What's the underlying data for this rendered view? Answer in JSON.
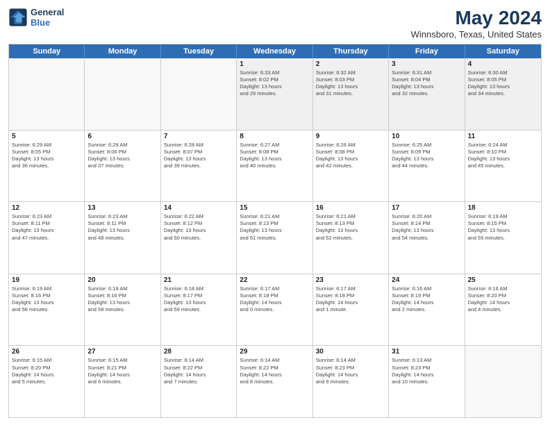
{
  "logo": {
    "line1": "General",
    "line2": "Blue"
  },
  "title": "May 2024",
  "subtitle": "Winnsboro, Texas, United States",
  "header_days": [
    "Sunday",
    "Monday",
    "Tuesday",
    "Wednesday",
    "Thursday",
    "Friday",
    "Saturday"
  ],
  "weeks": [
    [
      {
        "day": "",
        "info": ""
      },
      {
        "day": "",
        "info": ""
      },
      {
        "day": "",
        "info": ""
      },
      {
        "day": "1",
        "info": "Sunrise: 6:33 AM\nSunset: 8:02 PM\nDaylight: 13 hours\nand 29 minutes."
      },
      {
        "day": "2",
        "info": "Sunrise: 6:32 AM\nSunset: 8:03 PM\nDaylight: 13 hours\nand 31 minutes."
      },
      {
        "day": "3",
        "info": "Sunrise: 6:31 AM\nSunset: 8:04 PM\nDaylight: 13 hours\nand 32 minutes."
      },
      {
        "day": "4",
        "info": "Sunrise: 6:30 AM\nSunset: 8:05 PM\nDaylight: 13 hours\nand 34 minutes."
      }
    ],
    [
      {
        "day": "5",
        "info": "Sunrise: 6:29 AM\nSunset: 8:05 PM\nDaylight: 13 hours\nand 36 minutes."
      },
      {
        "day": "6",
        "info": "Sunrise: 6:28 AM\nSunset: 8:06 PM\nDaylight: 13 hours\nand 37 minutes."
      },
      {
        "day": "7",
        "info": "Sunrise: 6:28 AM\nSunset: 8:07 PM\nDaylight: 13 hours\nand 39 minutes."
      },
      {
        "day": "8",
        "info": "Sunrise: 6:27 AM\nSunset: 8:08 PM\nDaylight: 13 hours\nand 40 minutes."
      },
      {
        "day": "9",
        "info": "Sunrise: 6:26 AM\nSunset: 8:08 PM\nDaylight: 13 hours\nand 42 minutes."
      },
      {
        "day": "10",
        "info": "Sunrise: 6:25 AM\nSunset: 8:09 PM\nDaylight: 13 hours\nand 44 minutes."
      },
      {
        "day": "11",
        "info": "Sunrise: 6:24 AM\nSunset: 8:10 PM\nDaylight: 13 hours\nand 45 minutes."
      }
    ],
    [
      {
        "day": "12",
        "info": "Sunrise: 6:23 AM\nSunset: 8:11 PM\nDaylight: 13 hours\nand 47 minutes."
      },
      {
        "day": "13",
        "info": "Sunrise: 6:23 AM\nSunset: 8:11 PM\nDaylight: 13 hours\nand 48 minutes."
      },
      {
        "day": "14",
        "info": "Sunrise: 6:22 AM\nSunset: 8:12 PM\nDaylight: 13 hours\nand 50 minutes."
      },
      {
        "day": "15",
        "info": "Sunrise: 6:21 AM\nSunset: 8:13 PM\nDaylight: 13 hours\nand 51 minutes."
      },
      {
        "day": "16",
        "info": "Sunrise: 6:21 AM\nSunset: 8:13 PM\nDaylight: 13 hours\nand 52 minutes."
      },
      {
        "day": "17",
        "info": "Sunrise: 6:20 AM\nSunset: 8:14 PM\nDaylight: 13 hours\nand 54 minutes."
      },
      {
        "day": "18",
        "info": "Sunrise: 6:19 AM\nSunset: 8:15 PM\nDaylight: 13 hours\nand 55 minutes."
      }
    ],
    [
      {
        "day": "19",
        "info": "Sunrise: 6:19 AM\nSunset: 8:16 PM\nDaylight: 13 hours\nand 56 minutes."
      },
      {
        "day": "20",
        "info": "Sunrise: 6:18 AM\nSunset: 8:16 PM\nDaylight: 13 hours\nand 58 minutes."
      },
      {
        "day": "21",
        "info": "Sunrise: 6:18 AM\nSunset: 8:17 PM\nDaylight: 13 hours\nand 59 minutes."
      },
      {
        "day": "22",
        "info": "Sunrise: 6:17 AM\nSunset: 8:18 PM\nDaylight: 14 hours\nand 0 minutes."
      },
      {
        "day": "23",
        "info": "Sunrise: 6:17 AM\nSunset: 8:18 PM\nDaylight: 14 hours\nand 1 minute."
      },
      {
        "day": "24",
        "info": "Sunrise: 6:16 AM\nSunset: 8:19 PM\nDaylight: 14 hours\nand 2 minutes."
      },
      {
        "day": "25",
        "info": "Sunrise: 6:16 AM\nSunset: 8:20 PM\nDaylight: 14 hours\nand 4 minutes."
      }
    ],
    [
      {
        "day": "26",
        "info": "Sunrise: 6:15 AM\nSunset: 8:20 PM\nDaylight: 14 hours\nand 5 minutes."
      },
      {
        "day": "27",
        "info": "Sunrise: 6:15 AM\nSunset: 8:21 PM\nDaylight: 14 hours\nand 6 minutes."
      },
      {
        "day": "28",
        "info": "Sunrise: 6:14 AM\nSunset: 8:22 PM\nDaylight: 14 hours\nand 7 minutes."
      },
      {
        "day": "29",
        "info": "Sunrise: 6:14 AM\nSunset: 8:22 PM\nDaylight: 14 hours\nand 8 minutes."
      },
      {
        "day": "30",
        "info": "Sunrise: 6:14 AM\nSunset: 8:23 PM\nDaylight: 14 hours\nand 9 minutes."
      },
      {
        "day": "31",
        "info": "Sunrise: 6:13 AM\nSunset: 8:23 PM\nDaylight: 14 hours\nand 10 minutes."
      },
      {
        "day": "",
        "info": ""
      }
    ]
  ]
}
